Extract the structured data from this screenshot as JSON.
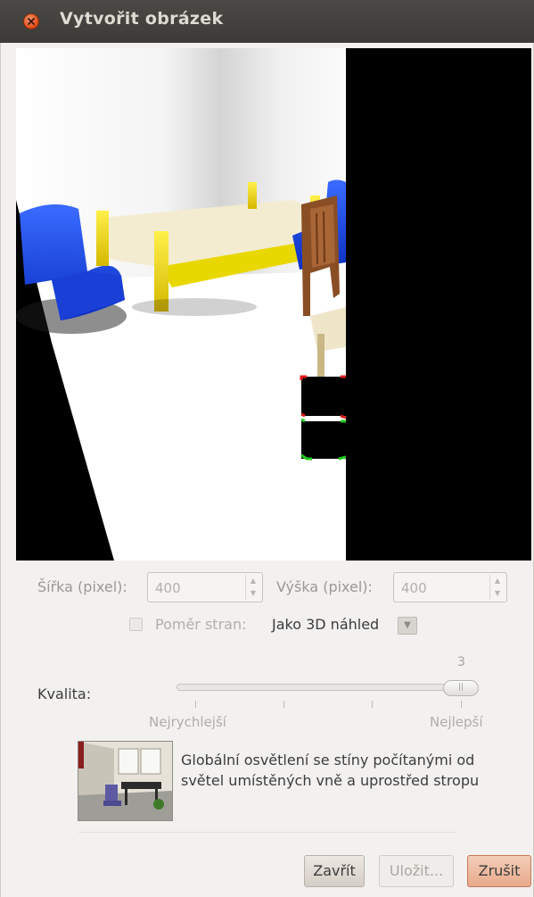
{
  "window": {
    "title": "Vytvořit obrázek"
  },
  "size": {
    "width_label": "Šířka (pixel):",
    "width_value": "400",
    "height_label": "Výška (pixel):",
    "height_value": "400"
  },
  "aspect": {
    "checkbox_label": "Poměr stran:",
    "checked": false,
    "selected_value": "Jako 3D náhled"
  },
  "quality": {
    "label": "Kvalita:",
    "value": "3",
    "min_label": "Nejrychlejší",
    "max_label": "Nejlepší",
    "description": "Globální osvětlení se stíny počítanými od světel umístěných vně a uprostřed stropu"
  },
  "buttons": {
    "close_label": "Zavřít",
    "save_label": "Uložit...",
    "cancel_label": "Zrušit"
  },
  "colors": {
    "titlebar": "#3c3b37",
    "close_button": "#df4a16",
    "cancel_button": "#e8a98b"
  },
  "icons": {
    "close": "close-icon",
    "combo": "chevron-down-icon"
  }
}
